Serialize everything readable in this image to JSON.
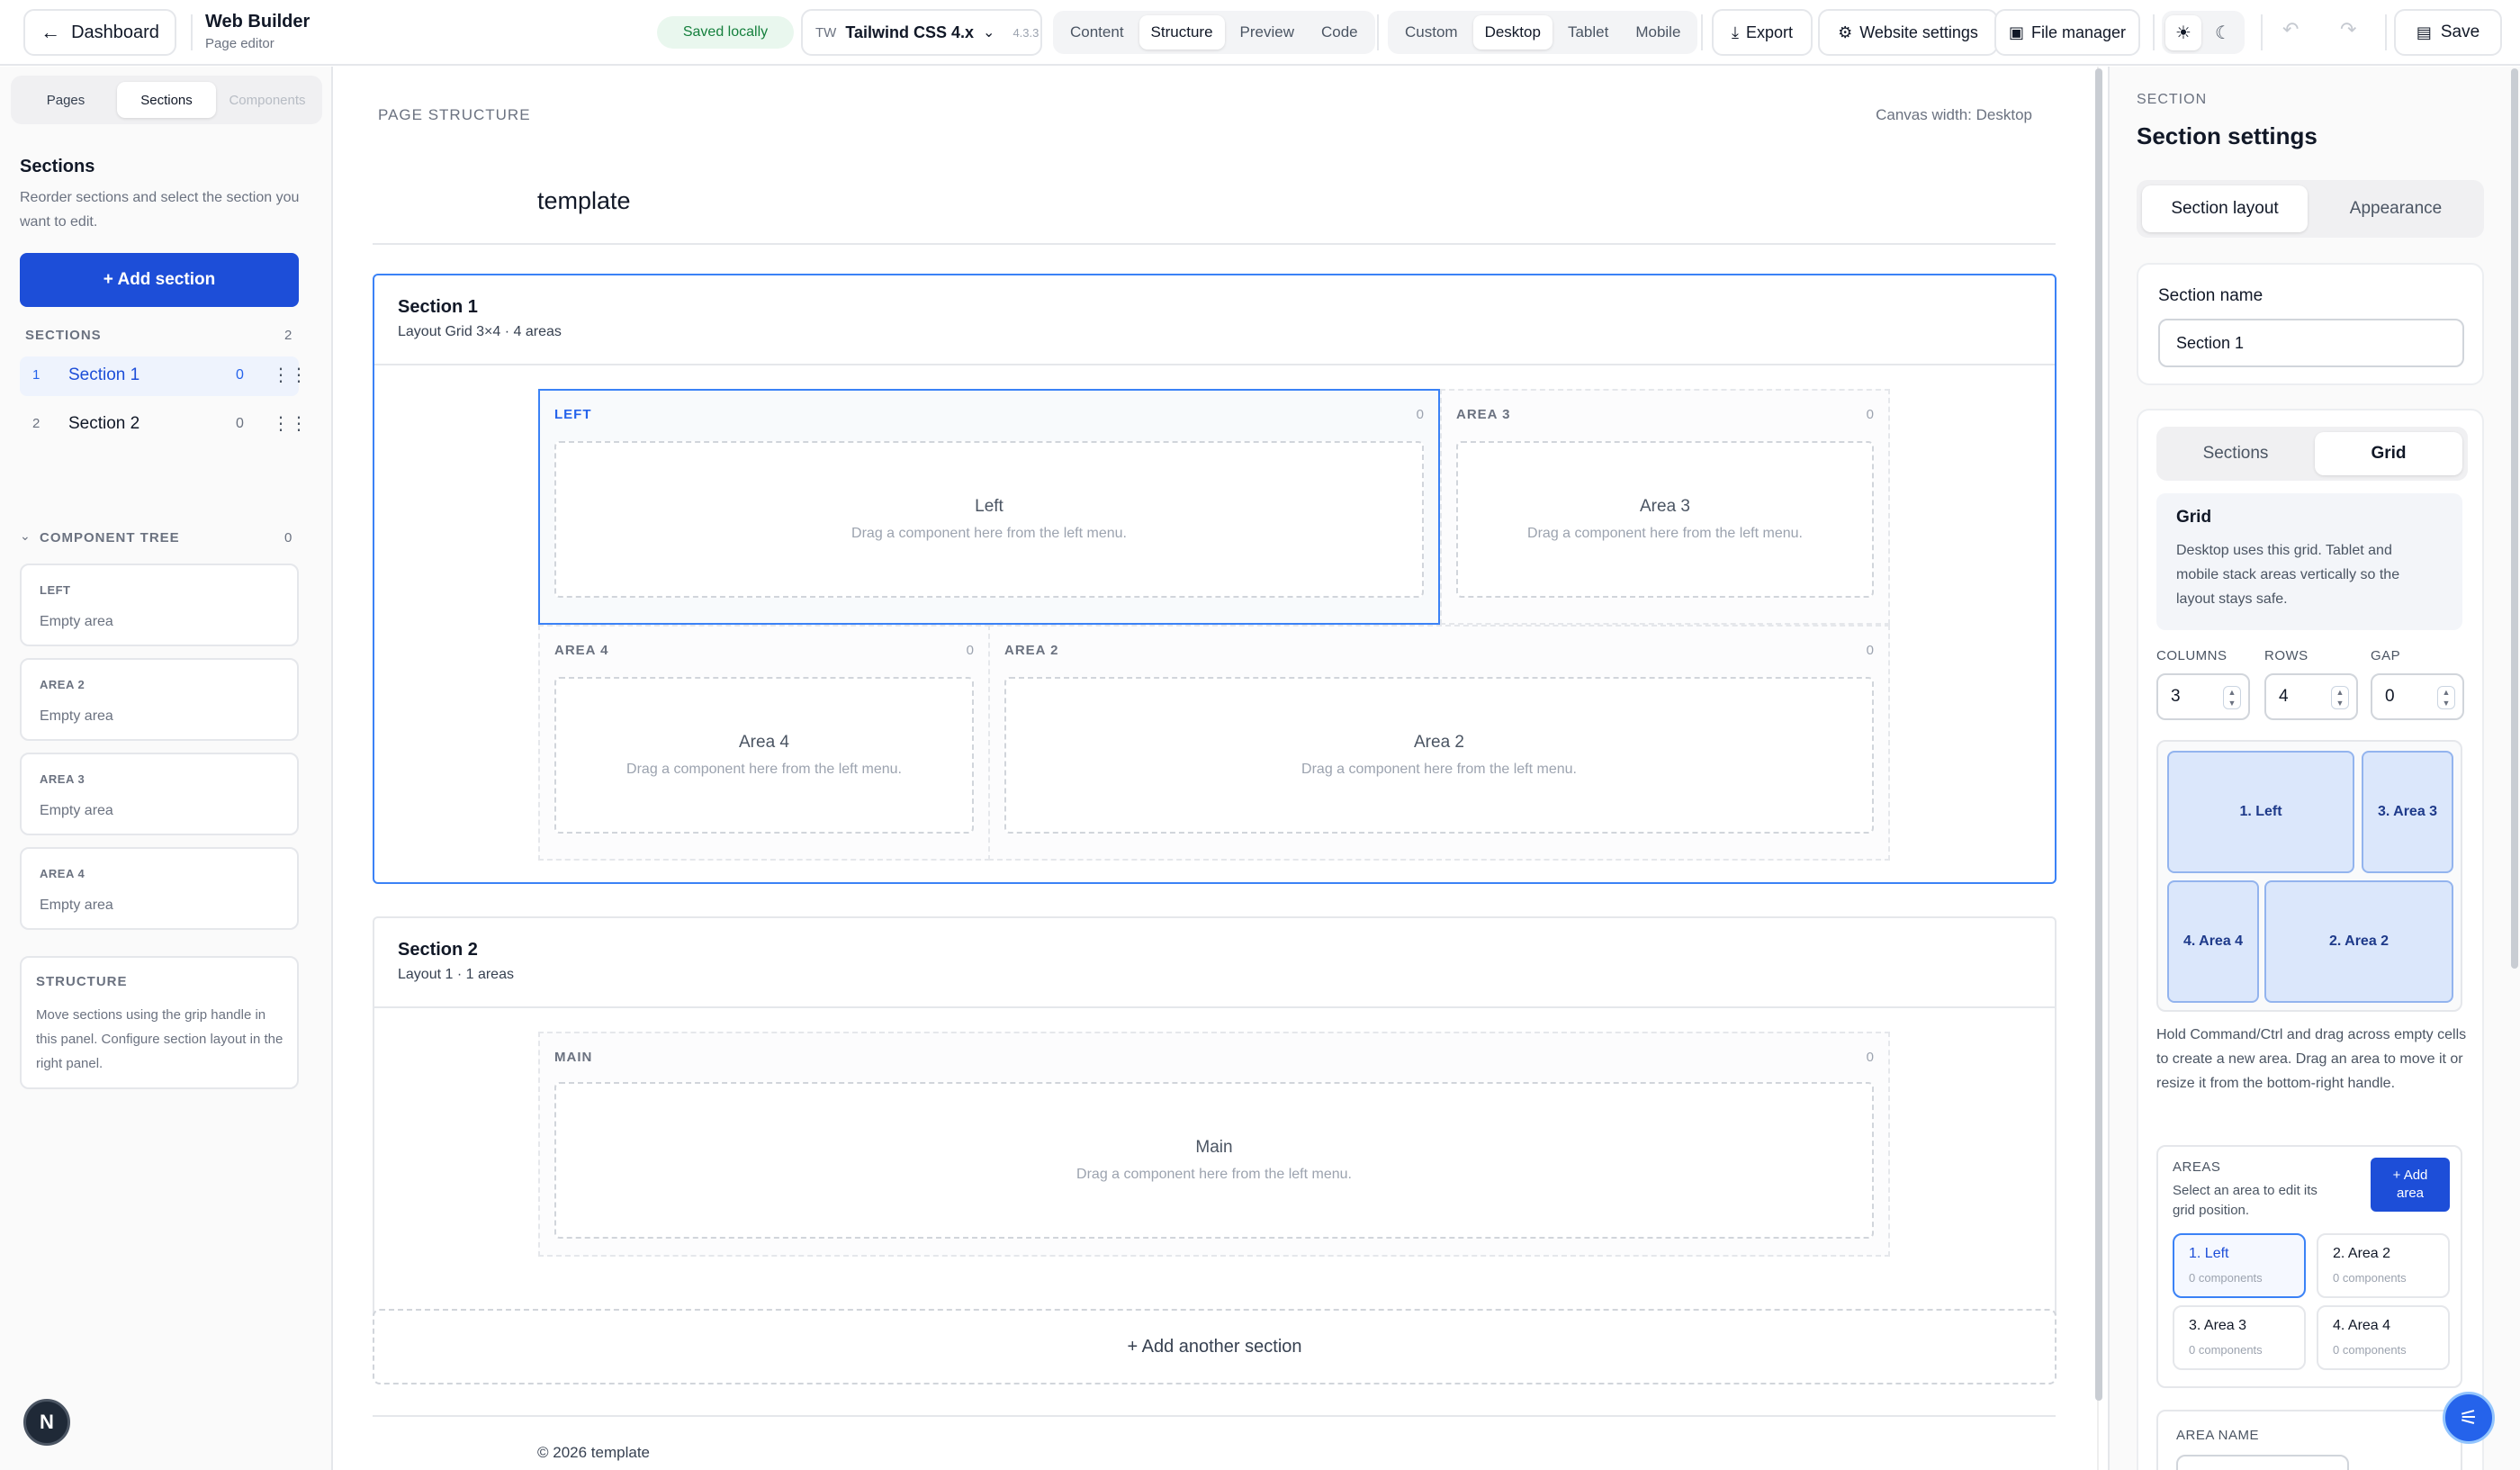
{
  "topbar": {
    "back_label": "Dashboard",
    "app_title": "Web Builder",
    "app_subtitle": "Page editor",
    "save_status": "Saved locally",
    "framework_prefix": "TW",
    "framework_name": "Tailwind CSS 4.x",
    "framework_version": "4.3.3",
    "mode_tabs": [
      "Content",
      "Structure",
      "Preview",
      "Code"
    ],
    "mode_active": "Structure",
    "device_tabs": [
      "Custom",
      "Desktop",
      "Tablet",
      "Mobile"
    ],
    "device_active": "Desktop",
    "export_label": "Export",
    "website_settings_label": "Website settings",
    "file_manager_label": "File manager",
    "save_label": "Save"
  },
  "left": {
    "tabs": [
      "Pages",
      "Sections",
      "Components"
    ],
    "active_tab": "Sections",
    "title": "Sections",
    "description": "Reorder sections and select the section you want to edit.",
    "add_button": "+ Add section",
    "sections_heading": "SECTIONS",
    "sections_count": "2",
    "sections": [
      {
        "index": "1",
        "name": "Section 1",
        "count": "0"
      },
      {
        "index": "2",
        "name": "Section 2",
        "count": "0"
      }
    ],
    "tree_heading": "COMPONENT TREE",
    "tree_count": "0",
    "tree": [
      {
        "title": "LEFT",
        "empty": "Empty area"
      },
      {
        "title": "AREA 2",
        "empty": "Empty area"
      },
      {
        "title": "AREA 3",
        "empty": "Empty area"
      },
      {
        "title": "AREA 4",
        "empty": "Empty area"
      }
    ],
    "structure_title": "STRUCTURE",
    "structure_text": "Move sections using the grip handle in this panel. Configure section layout in the right panel.",
    "avatar_letter": "N"
  },
  "canvas": {
    "heading": "PAGE STRUCTURE",
    "width_label": "Canvas width: Desktop",
    "page_title": "template",
    "section1": {
      "title": "Section 1",
      "subtitle": "Layout Grid 3×4 · 4 areas",
      "areas": [
        {
          "label": "LEFT",
          "count": "0",
          "name": "Left",
          "hint": "Drag a component here from the left menu."
        },
        {
          "label": "AREA 3",
          "count": "0",
          "name": "Area 3",
          "hint": "Drag a component here from the left menu."
        },
        {
          "label": "AREA 4",
          "count": "0",
          "name": "Area 4",
          "hint": "Drag a component here from the left menu."
        },
        {
          "label": "AREA 2",
          "count": "0",
          "name": "Area 2",
          "hint": "Drag a component here from the left menu."
        }
      ]
    },
    "section2": {
      "title": "Section 2",
      "subtitle": "Layout 1 · 1 areas",
      "area": {
        "label": "MAIN",
        "count": "0",
        "name": "Main",
        "hint": "Drag a component here from the left menu."
      }
    },
    "add_another": "+ Add another section",
    "footer": "© 2026 template"
  },
  "right": {
    "eyebrow": "SECTION",
    "title": "Section settings",
    "tabs": [
      "Section layout",
      "Appearance"
    ],
    "active_tab": "Section layout",
    "name_label": "Section name",
    "name_value": "Section 1",
    "sub_tabs": [
      "Sections",
      "Grid"
    ],
    "active_sub_tab": "Grid",
    "grid_title": "Grid",
    "grid_text": "Desktop uses this grid. Tablet and mobile stack areas vertically so the layout stays safe.",
    "columns_label": "COLUMNS",
    "rows_label": "ROWS",
    "gap_label": "GAP",
    "columns": "3",
    "rows": "4",
    "gap": "0",
    "grid_cells": [
      "1. Left",
      "3. Area 3",
      "4. Area 4",
      "2. Area 2"
    ],
    "hint": "Hold Command/Ctrl and drag across empty cells to create a new area. Drag an area to move it or resize it from the bottom-right handle.",
    "areas_heading": "AREAS",
    "areas_text": "Select an area to edit its grid position.",
    "add_area": "+ Add area",
    "area_chips": [
      {
        "name": "1. Left",
        "sub": "0 components"
      },
      {
        "name": "2. Area 2",
        "sub": "0 components"
      },
      {
        "name": "3. Area 3",
        "sub": "0 components"
      },
      {
        "name": "4. Area 4",
        "sub": "0 components"
      }
    ],
    "area_name_label": "AREA NAME"
  }
}
